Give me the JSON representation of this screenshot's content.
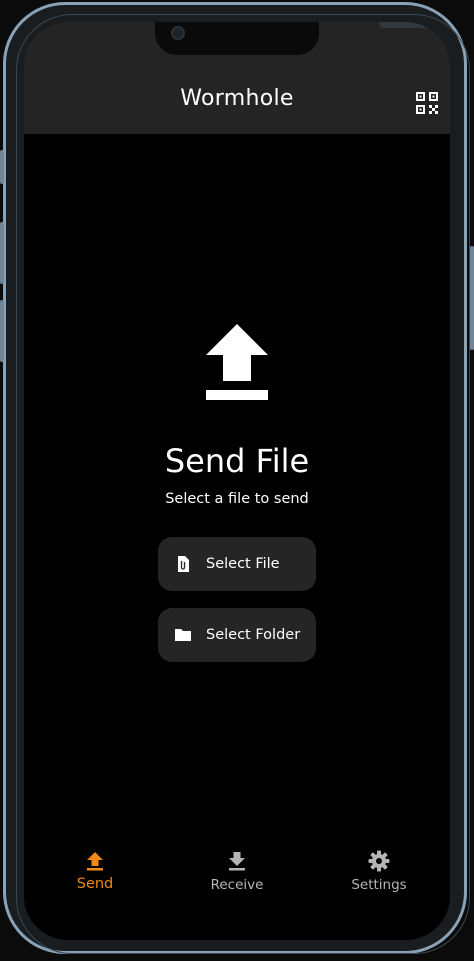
{
  "app": {
    "title": "Wormhole",
    "accent_color": "#f08a15",
    "appbar_color": "#242424",
    "background_color": "#000000"
  },
  "header": {
    "qr_icon": "qr-code-scanner-icon"
  },
  "main": {
    "hero_icon": "upload-icon",
    "title": "Send File",
    "subtitle": "Select a file to send",
    "buttons": [
      {
        "label": "Select File",
        "icon": "attach-file-icon"
      },
      {
        "label": "Select Folder",
        "icon": "folder-icon"
      }
    ]
  },
  "nav": {
    "items": [
      {
        "label": "Send",
        "icon": "upload-icon",
        "selected": true
      },
      {
        "label": "Receive",
        "icon": "download-icon",
        "selected": false
      },
      {
        "label": "Settings",
        "icon": "gear-icon",
        "selected": false
      }
    ]
  }
}
